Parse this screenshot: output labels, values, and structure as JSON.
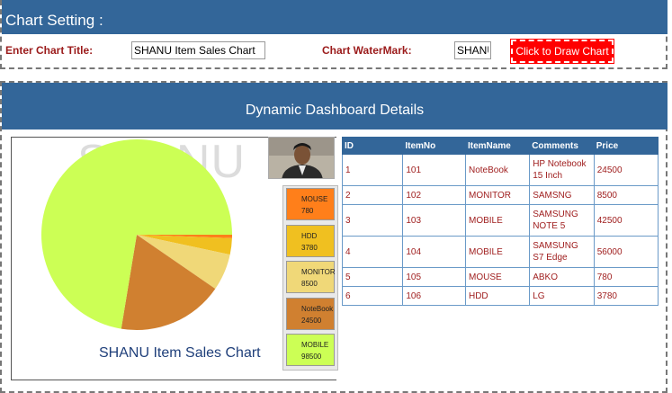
{
  "settings": {
    "header_title": "Chart Setting :",
    "title_label": "Enter Chart Title:",
    "title_value": "SHANU Item Sales Chart",
    "watermark_label": "Chart WaterMark:",
    "watermark_value": "SHANU",
    "draw_button": "Click to Draw Chart"
  },
  "dashboard": {
    "header_title": "Dynamic Dashboard Details"
  },
  "chart_data": {
    "type": "pie",
    "title": "SHANU Item Sales Chart",
    "watermark": "SHANU",
    "legend_position": "right",
    "slices": [
      {
        "name": "MOUSE",
        "value": 780,
        "color": "#ff7f1a"
      },
      {
        "name": "HDD",
        "value": 3780,
        "color": "#f0c020"
      },
      {
        "name": "MONITOR",
        "value": 8500,
        "color": "#f0d878"
      },
      {
        "name": "NoteBook",
        "value": 24500,
        "color": "#d08030"
      },
      {
        "name": "MOBILE",
        "value": 98500,
        "color": "#ccff55"
      }
    ]
  },
  "table": {
    "columns": [
      "ID",
      "ItemNo",
      "ItemName",
      "Comments",
      "Price"
    ],
    "rows": [
      [
        "1",
        "101",
        "NoteBook",
        "HP Notebook 15 Inch",
        "24500"
      ],
      [
        "2",
        "102",
        "MONITOR",
        "SAMSNG",
        "8500"
      ],
      [
        "3",
        "103",
        "MOBILE",
        "SAMSUNG NOTE 5",
        "42500"
      ],
      [
        "4",
        "104",
        "MOBILE",
        "SAMSUNG S7 Edge",
        "56000"
      ],
      [
        "5",
        "105",
        "MOUSE",
        "ABKO",
        "780"
      ],
      [
        "6",
        "106",
        "HDD",
        "LG",
        "3780"
      ]
    ]
  }
}
